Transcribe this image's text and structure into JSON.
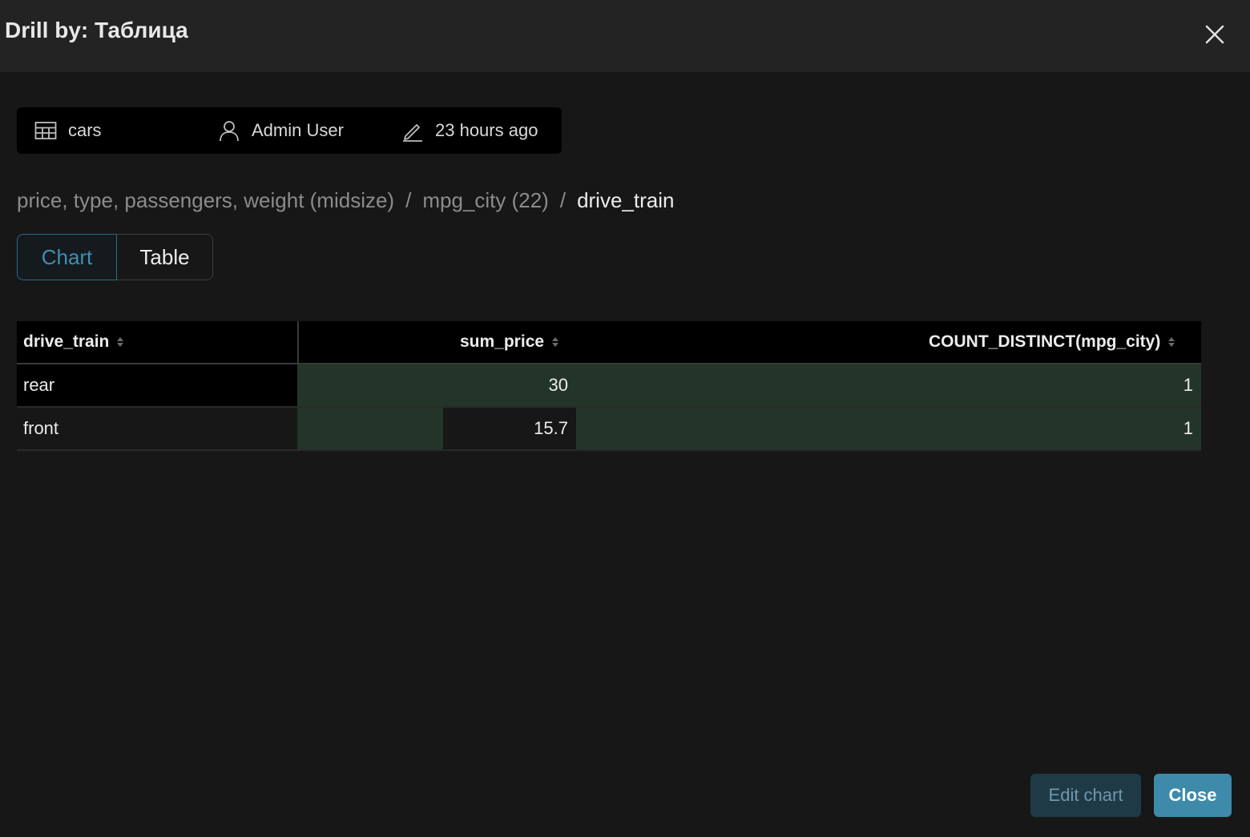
{
  "modal": {
    "title": "Drill by: Таблица",
    "close_icon": "close-icon"
  },
  "meta": {
    "dataset": {
      "icon": "table-icon",
      "label": "cars"
    },
    "owner": {
      "icon": "user-icon",
      "label": "Admin User"
    },
    "modified": {
      "icon": "edit-icon",
      "label": "23 hours ago"
    }
  },
  "breadcrumb": {
    "items": [
      "price, type, passengers, weight (midsize)",
      "mpg_city (22)"
    ],
    "separator": "/",
    "current": "drive_train"
  },
  "view_toggle": {
    "chart_label": "Chart",
    "table_label": "Table",
    "selected": "Chart"
  },
  "table": {
    "columns": [
      "drive_train",
      "sum_price",
      "COUNT_DISTINCT(mpg_city)"
    ],
    "rows": [
      {
        "drive_train": "rear",
        "sum_price": "30",
        "count_distinct": "1"
      },
      {
        "drive_train": "front",
        "sum_price": "15.7",
        "count_distinct": "1"
      }
    ],
    "cell_bar_color": "#233529",
    "sum_price_fraction": [
      1.0,
      0.5233
    ],
    "count_distinct_fraction": [
      1.0,
      1.0
    ]
  },
  "footer": {
    "edit_label": "Edit chart",
    "close_label": "Close"
  },
  "colors": {
    "accent": "#3d8aab",
    "background": "#171717",
    "header_bg": "#232323"
  }
}
